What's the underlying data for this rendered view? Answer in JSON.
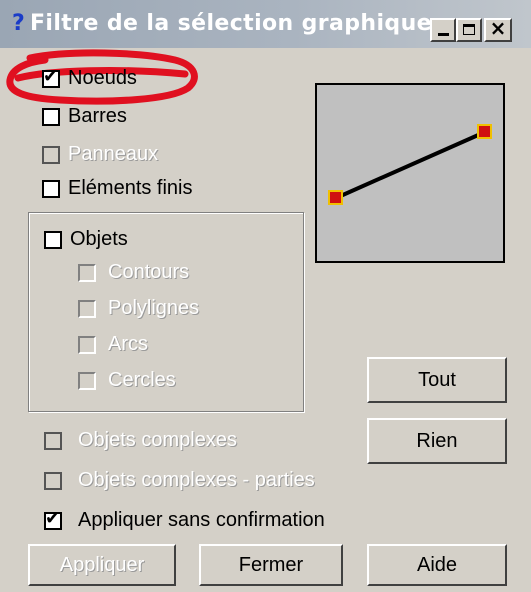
{
  "window": {
    "title": "Filtre de la sélection graphique",
    "help_glyph": "?",
    "min_icon": "minimize-icon",
    "max_icon": "maximize-icon",
    "close_glyph": "×"
  },
  "filters": [
    {
      "label": "Noeuds",
      "checked": true,
      "enabled": true
    },
    {
      "label": "Barres",
      "checked": false,
      "enabled": true
    },
    {
      "label": "Panneaux",
      "checked": false,
      "enabled": false
    },
    {
      "label": "Eléments finis",
      "checked": false,
      "enabled": true
    }
  ],
  "objects_group": {
    "label": "Objets",
    "items": [
      {
        "label": "Contours",
        "enabled": false
      },
      {
        "label": "Polylignes",
        "enabled": false
      },
      {
        "label": "Arcs",
        "enabled": false
      },
      {
        "label": "Cercles",
        "enabled": false
      }
    ]
  },
  "complex": [
    {
      "label": "Objets complexes",
      "enabled": false
    },
    {
      "label": "Objets complexes - parties",
      "enabled": false
    }
  ],
  "apply_without_confirm": {
    "label": "Appliquer sans confirmation",
    "checked": true
  },
  "buttons": {
    "tout": "Tout",
    "rien": "Rien",
    "appliquer": "Appliquer",
    "fermer": "Fermer",
    "aide": "Aide"
  },
  "colors": {
    "preview_bg": "#c0c0c0",
    "node": "#d01010",
    "node_border": "#f0c000",
    "annotation": "#e01020"
  }
}
